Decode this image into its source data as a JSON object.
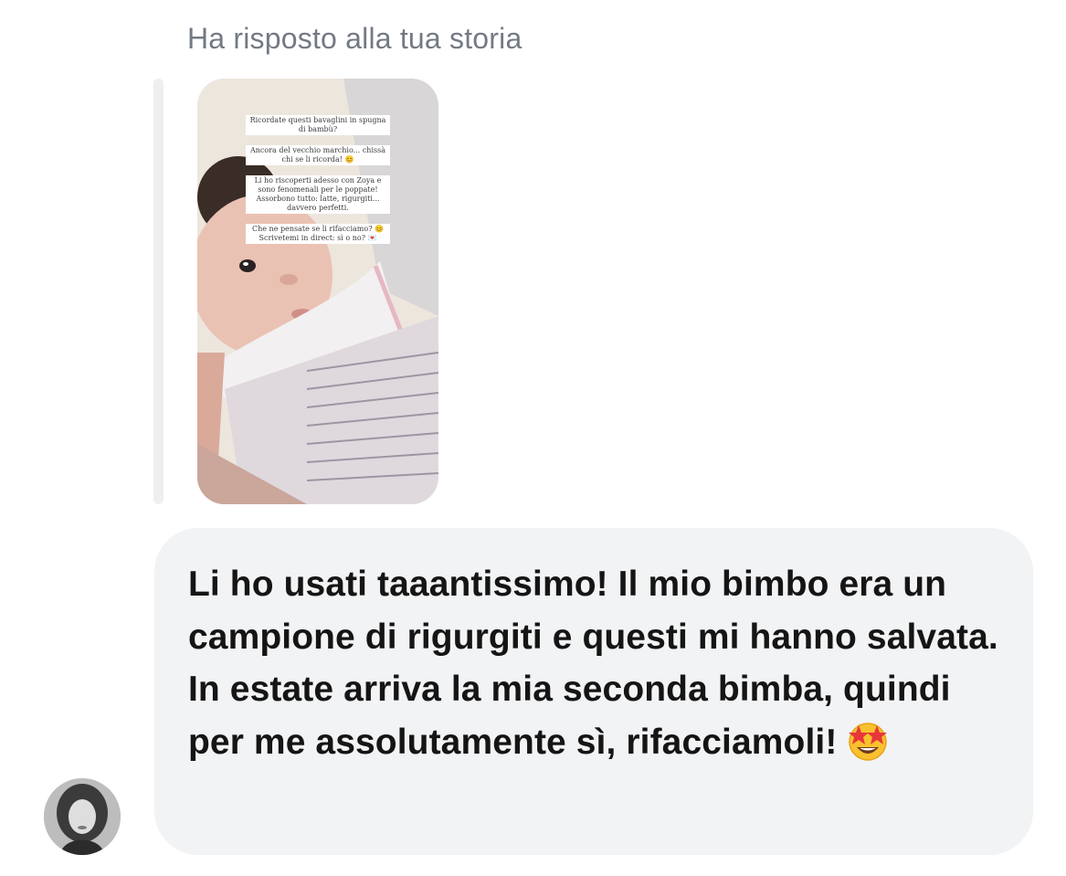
{
  "header": {
    "reply_label": "Ha risposto alla tua storia"
  },
  "story": {
    "lines": [
      "Ricordate questi bavaglini in spugna di bambù?",
      "Ancora del vecchio marchio... chissà chi se li ricorda! 😊",
      "Li ho riscoperti adesso con Zoya e sono fenomenali per le poppate! Assorbono tutto: latte, rigurgiti... davvero perfetti.",
      "Che ne pensate se li rifacciamo? 😊 Scrivetemi in direct: sì o no? 💌"
    ]
  },
  "message": {
    "text": "Li ho usati taaantissimo! Il mio bimbo era un campione di rigurgiti e questi mi hanno salvata. In estate arriva la mia seconda bimba, quindi per me assolutamente sì, rifacciamoli!",
    "emoji": "star-struck-emoji"
  },
  "avatar": {
    "icon": "user-avatar"
  },
  "colors": {
    "bubble_background": "#f2f3f5",
    "label_gray": "#737a84",
    "quote_bar": "#efeff1",
    "text": "#151515"
  }
}
